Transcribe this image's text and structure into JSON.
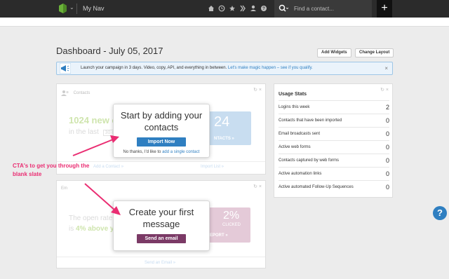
{
  "topnav": {
    "title": "My Nav",
    "caret": "⌄",
    "search_placeholder": "Find a contact...",
    "plus_label": "+",
    "icons": [
      "home-icon",
      "clock-icon",
      "star-icon",
      "flask-icon",
      "person-icon",
      "help-icon"
    ]
  },
  "header": {
    "title": "Dashboard - July 05, 2017",
    "add_widgets_label": "Add Widgets",
    "change_layout_label": "Change Layout"
  },
  "banner": {
    "text": "Launch your campaign in 3 days. Video, copy, API, and everything in between.",
    "link": "Let's make magic happen – see if you qualify.",
    "close": "×"
  },
  "contacts_card": {
    "heading": "Contacts",
    "tools": "↻ ×",
    "faded_big": "1024 new c",
    "faded_line": "in the last",
    "faded_chip": "30 d",
    "faded_number": "24",
    "faded_contacts_link": "NTACTS »",
    "faded_add_contact": "Add a Contact »",
    "faded_import_list": "Import List »",
    "overlay_title": "Start by adding your contacts",
    "cta_label": "Import Now",
    "no_thanks_text": "No thanks, I'd like to",
    "no_thanks_link": "add a single contact"
  },
  "email_card": {
    "heading": "Em",
    "tools": "↻ ×",
    "faded_line1": "The open rate",
    "faded_line2_prefix": "is",
    "faded_line2_green": "4% above y",
    "faded_percent": "2%",
    "faded_clicked": "CLICKED",
    "faded_report": "EPORT »",
    "faded_send_email": "Send an Email »",
    "overlay_title": "Create your first message",
    "cta_label": "Send an email"
  },
  "usage_stats": {
    "title": "Usage Stats",
    "tools": "↻ ×",
    "rows": [
      {
        "label": "Logins this week",
        "value": "2"
      },
      {
        "label": "Contacts that have been imported",
        "value": "0"
      },
      {
        "label": "Email broadcasts sent",
        "value": "0"
      },
      {
        "label": "Active web forms",
        "value": "0"
      },
      {
        "label": "Contacts captured by web forms",
        "value": "0"
      },
      {
        "label": "Active automation links",
        "value": "0"
      },
      {
        "label": "Active automated Follow-Up Sequences",
        "value": "0"
      }
    ]
  },
  "annotation": {
    "text": "CTA's to get you through the blank slate"
  },
  "help_button": "?",
  "colors": {
    "nav_bg": "#2b2b2b",
    "accent_blue": "#2f7fc1",
    "cta_purple": "#7b3a66",
    "annotation_pink": "#ea2d72"
  }
}
